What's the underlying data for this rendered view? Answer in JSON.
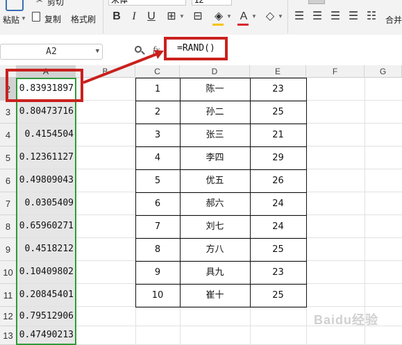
{
  "ribbon": {
    "cut_label": "剪切",
    "paste_label": "粘贴",
    "copy_label": "复制",
    "format_painter_label": "格式刷",
    "font_name": "宋体",
    "font_size": "12",
    "merge_label": "合并"
  },
  "formula_bar": {
    "name_box": "A2",
    "fx_label": "fx",
    "formula": "=RAND()"
  },
  "columns": [
    "A",
    "B",
    "C",
    "D",
    "E",
    "F",
    "G"
  ],
  "rows": [
    "2",
    "3",
    "4",
    "5",
    "6",
    "7",
    "8",
    "9",
    "10",
    "11",
    "12",
    "13"
  ],
  "column_a_values": [
    "0.83931897",
    "0.80473716",
    "0.4154504",
    "0.12361127",
    "0.49809043",
    "0.0305409",
    "0.65960271",
    "0.4518212",
    "0.10409802",
    "0.20845401",
    "0.79512906",
    "0.47490213"
  ],
  "table": [
    {
      "num": "1",
      "name": "陈一",
      "age": "23"
    },
    {
      "num": "2",
      "name": "孙二",
      "age": "25"
    },
    {
      "num": "3",
      "name": "张三",
      "age": "21"
    },
    {
      "num": "4",
      "name": "李四",
      "age": "29"
    },
    {
      "num": "5",
      "name": "优五",
      "age": "26"
    },
    {
      "num": "6",
      "name": "郝六",
      "age": "24"
    },
    {
      "num": "7",
      "name": "刘七",
      "age": "24"
    },
    {
      "num": "8",
      "name": "方八",
      "age": "25"
    },
    {
      "num": "9",
      "name": "具九",
      "age": "23"
    },
    {
      "num": "10",
      "name": "崔十",
      "age": "25"
    }
  ],
  "watermark": "Baidu经验",
  "colors": {
    "highlight_red": "#c9211e",
    "selection_green": "#2f9a3a",
    "font_color_red": "#d9262b"
  }
}
